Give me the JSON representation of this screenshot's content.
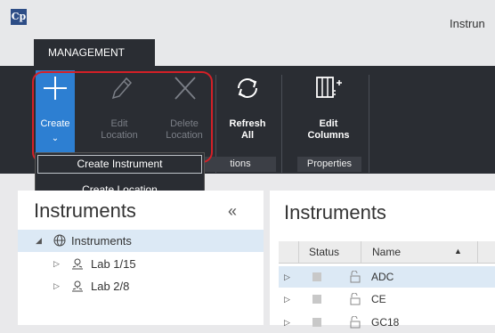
{
  "app": {
    "logo_text": "Cp",
    "window_title": "Instrun"
  },
  "ribbon": {
    "tab_label": "MANAGEMENT",
    "create_label": "Create",
    "edit_location_label": "Edit\nLocation",
    "delete_location_label": "Delete\nLocation",
    "refresh_label": "Refresh\nAll",
    "edit_columns_label": "Edit\nColumns",
    "group_partial_label": "tions",
    "properties_group_label": "Properties"
  },
  "dropdown": {
    "items": [
      "Create Instrument",
      "Create Location"
    ]
  },
  "left_panel": {
    "title": "Instruments",
    "collapse_glyph": "«",
    "tree": [
      {
        "label": "Instruments"
      },
      {
        "label": "Lab 1/15"
      },
      {
        "label": "Lab 2/8"
      }
    ]
  },
  "right_panel": {
    "title": "Instruments",
    "columns": [
      "Status",
      "Name"
    ],
    "rows": [
      {
        "name": "ADC"
      },
      {
        "name": "CE"
      },
      {
        "name": "GC18"
      }
    ]
  },
  "colors": {
    "accent": "#2d7fd2",
    "ribbon_bg": "#2a2d33",
    "highlight_ring": "#d42027",
    "selection": "#dce9f5"
  }
}
